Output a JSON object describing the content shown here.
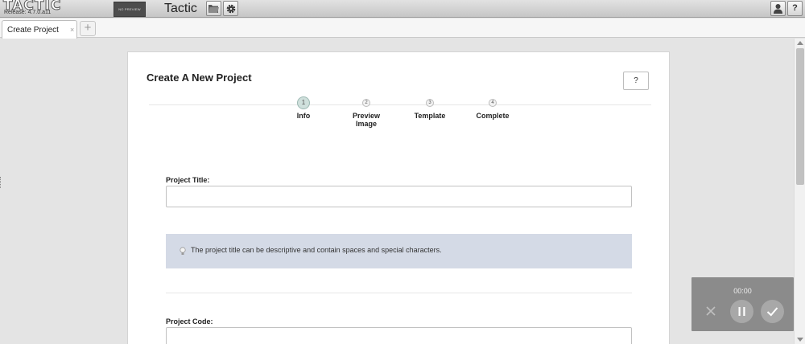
{
  "header": {
    "logo_text": "TACTIC",
    "release": "Release: 4.7.0.a11",
    "no_preview": "NO PREVIEW",
    "app_title": "Tactic",
    "icons": [
      "folder-icon",
      "gear-icon",
      "user-icon",
      "help-icon"
    ],
    "help_label": "?"
  },
  "tabs": {
    "items": [
      {
        "label": "Create Project",
        "close": "×"
      }
    ],
    "add_label": "+"
  },
  "wizard": {
    "title": "Create A New Project",
    "help_label": "?",
    "steps": [
      {
        "number": "1",
        "label": "Info",
        "active": true
      },
      {
        "number": "2",
        "label": "Preview Image",
        "active": false
      },
      {
        "number": "3",
        "label": "Template",
        "active": false
      },
      {
        "number": "4",
        "label": "Complete",
        "active": false
      }
    ],
    "project_title": {
      "label": "Project Title:",
      "value": "",
      "placeholder": ""
    },
    "hint": "The project title can be descriptive and contain spaces and special characters.",
    "project_code": {
      "label": "Project Code:",
      "value": "",
      "placeholder": ""
    }
  },
  "recorder": {
    "time": "00:00",
    "icons": [
      "close-icon",
      "pause-icon",
      "check-icon"
    ]
  },
  "colors": {
    "active_step": "#cfe0dc",
    "hint_background": "#d4dae6",
    "recorder_background": "#787878"
  }
}
